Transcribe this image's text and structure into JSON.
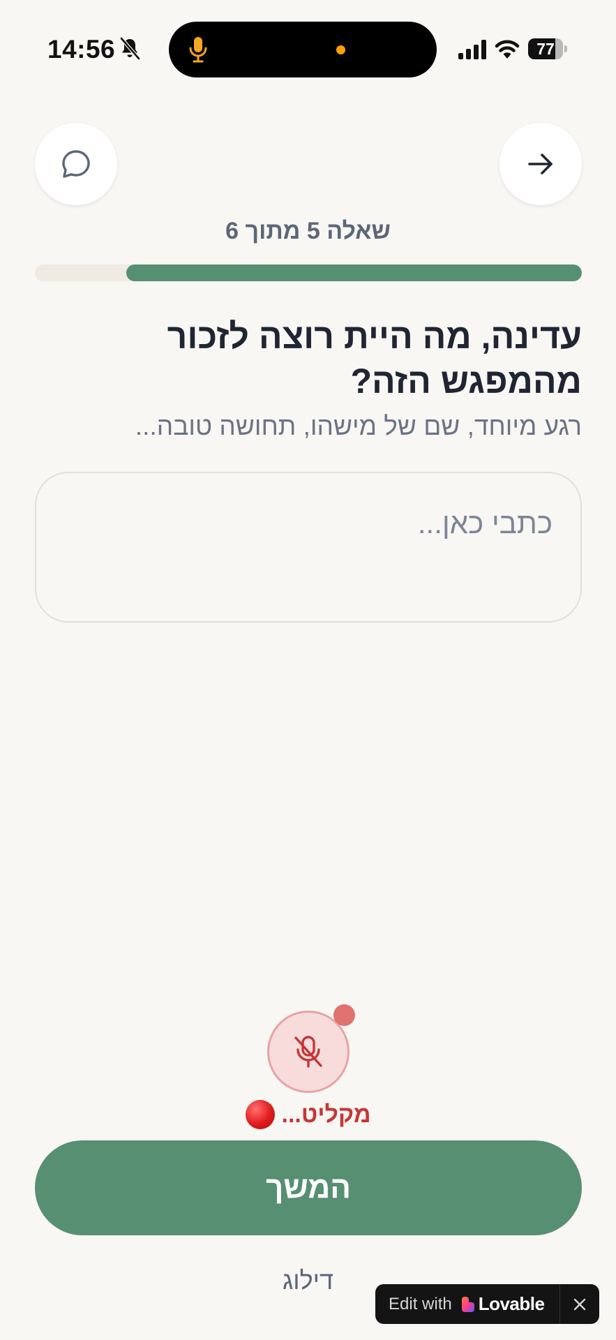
{
  "status_bar": {
    "time": "14:56",
    "battery_level": "77",
    "battery_fraction": 0.77
  },
  "icons": {
    "chat": "chat-bubble-icon",
    "next": "arrow-right-icon",
    "mic": "mic-off-icon",
    "bell": "bell-muted-icon"
  },
  "progress": {
    "label": "שאלה 5 מתוך 6",
    "fraction": 0.833
  },
  "question": {
    "title": "עדינה, מה היית רוצה לזכור מהמפגש הזה?",
    "hint": "רגע מיוחד, שם של מישהו, תחושה טובה..."
  },
  "answer": {
    "placeholder": "כתבי כאן...",
    "value": ""
  },
  "recording": {
    "status_text": "מקליט..."
  },
  "actions": {
    "continue_label": "המשך",
    "skip_label": "דילוג"
  },
  "lovable": {
    "edit_with": "Edit with",
    "brand": "Lovable"
  },
  "colors": {
    "accent": "#568f72",
    "background": "#f9f7f4",
    "recording": "#c73636"
  }
}
